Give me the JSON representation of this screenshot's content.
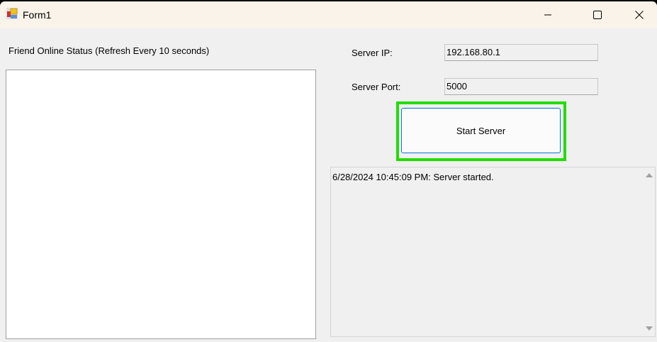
{
  "window": {
    "title": "Form1",
    "icon": "winforms-app-icon"
  },
  "controls": {
    "minimize": "minimize-icon",
    "maximize": "maximize-icon",
    "close": "close-icon"
  },
  "friends": {
    "label": "Friend Online Status (Refresh Every 10 seconds)",
    "items": []
  },
  "server": {
    "ip_label": "Server IP:",
    "ip_value": "192.168.80.1",
    "port_label": "Server Port:",
    "port_value": "5000",
    "start_label": "Start Server"
  },
  "log": {
    "lines": [
      "6/28/2024 10:45:09 PM: Server started."
    ]
  },
  "colors": {
    "highlight": "#22dd00",
    "title_bg": "#f9f3ea",
    "body_bg": "#f0f0f0"
  }
}
